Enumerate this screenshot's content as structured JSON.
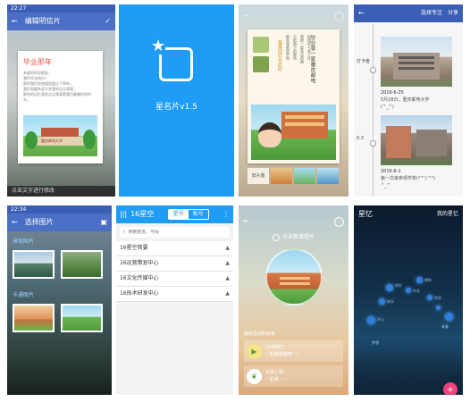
{
  "p1": {
    "status_time": "22:27",
    "title": "编辑明信片",
    "card_heading": "毕业那年",
    "card_lines": [
      "亲爱的同志朋友，",
      "我们毕业快乐！",
      "那时我们在校园里度过了四年，",
      "我们同窗共读大学里的点点滴滴，",
      "那些的记忆里的点点滴滴是我们最美好的时光。"
    ],
    "school_sign": "重庆邮电大学",
    "footer_hint": "点击文字进行修改"
  },
  "p2": {
    "app_name": "星名片v1.5"
  },
  "p3": {
    "vertical_title": "毕业季一家重庆邮电",
    "vertical_sub": "最美回忆在此时",
    "poem_lines": [
      "校园的人来人往",
      "曾经一起走过的路",
      "夕阳西下的操场",
      "那些熟悉的声音",
      "都留在记忆深处",
      "等到我们离开时"
    ],
    "thumb_label": "旧头像"
  },
  "p4": {
    "title_left": "选择专注",
    "title_right": "分享",
    "timeline_label_1": "打卡者",
    "date_1": "2016-6-25",
    "note_1a": "5月28日，重庆邮电大学",
    "note_1b": "(^_^)",
    "timeline_label_2": "0.3",
    "date_2": "2016-6-1",
    "note_2a": "第一次来参观学校(*^▽^*)",
    "note_2b": "^_^"
  },
  "p5": {
    "status_time": "22:34",
    "title": "选择图片",
    "section1": "景观图片",
    "section2": "卡通图片"
  },
  "p6": {
    "title": "16星空",
    "tab_active": "星号",
    "tab_other": "账号",
    "search_placeholder": "搜索姓名、号码",
    "items": [
      "16星空简要",
      "16运营策划中心",
      "16文化传媒中心",
      "16技术研发中心"
    ]
  },
  "p7": {
    "top_text": "点击新增照片",
    "list_header": "最新活动新鲜事",
    "item1_title": "16级新生",
    "item1_sub": "一起来聊聊吧~~",
    "item2_title": "记录心情",
    "item2_sub": "一起来~~"
  },
  "p8": {
    "title": "星忆",
    "right_label": "我的星忆",
    "labels": [
      "你好",
      "快乐",
      "开心",
      "毕业",
      "想你",
      "同学",
      "青春",
      "梦想"
    ],
    "fab_label": "+"
  },
  "colors": {
    "primary_blue": "#3b5fb4",
    "app_blue": "#1f9df6",
    "pink": "#f0407e"
  }
}
